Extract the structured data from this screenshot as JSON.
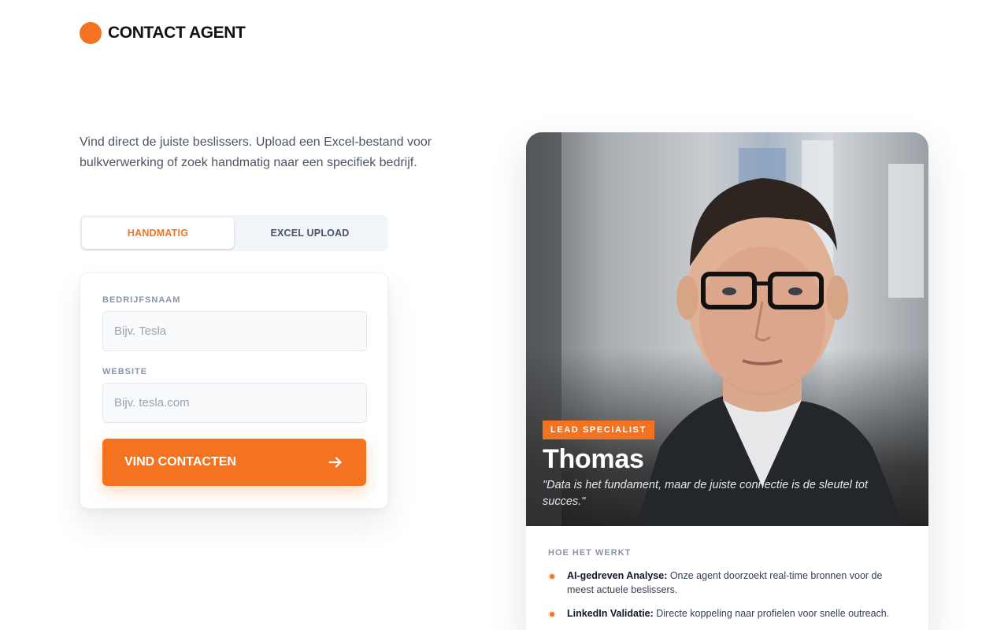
{
  "brand": {
    "name": "CONTACT AGENT"
  },
  "intro": {
    "text": "Vind direct de juiste beslissers. Upload een Excel-bestand voor bulkverwerking of zoek handmatig naar een specifiek bedrijf."
  },
  "tabs": [
    {
      "label": "HANDMATIG",
      "active": true
    },
    {
      "label": "EXCEL UPLOAD",
      "active": false
    }
  ],
  "form": {
    "company_label": "BEDRIJFSNAAM",
    "company_placeholder": "Bijv. Tesla",
    "company_value": "",
    "website_label": "WEBSITE",
    "website_placeholder": "Bijv. tesla.com",
    "website_value": "",
    "submit_label": "VIND CONTACTEN"
  },
  "agent": {
    "badge": "LEAD SPECIALIST",
    "name": "Thomas",
    "quote": "\"Data is het fundament, maar de juiste connectie is de sleutel tot succes.\""
  },
  "how": {
    "title": "HOE HET WERKT",
    "items": [
      {
        "title": "AI-gedreven Analyse:",
        "text": " Onze agent doorzoekt real-time bronnen voor de meest actuele beslissers."
      },
      {
        "title": "LinkedIn Validatie:",
        "text": " Directe koppeling naar profielen voor snelle outreach."
      }
    ]
  },
  "colors": {
    "accent": "#f47321",
    "text": "#4b5563"
  },
  "icons": {
    "submit": "arrow-right-icon",
    "brand": "brand-dot-icon"
  }
}
